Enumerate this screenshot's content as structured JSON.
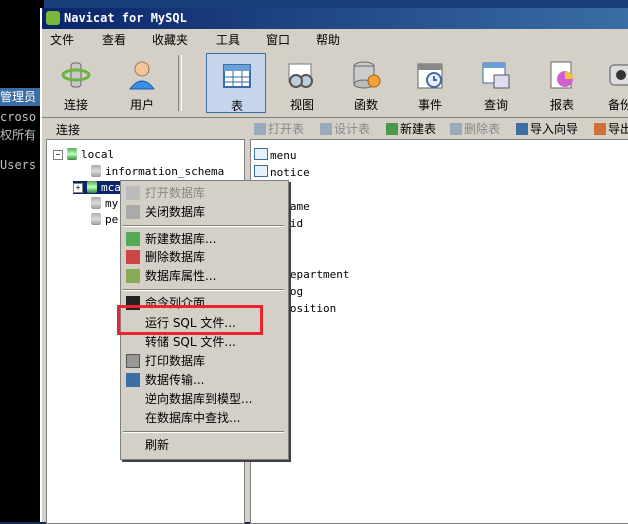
{
  "background": {
    "cmd_title": "管理员",
    "cmd_lines": [
      "croso",
      "权所有",
      "",
      "Users"
    ]
  },
  "window": {
    "title": "Navicat for MySQL"
  },
  "menubar": [
    "文件",
    "查看",
    "收藏夹",
    "工具",
    "窗口",
    "帮助"
  ],
  "toolbar": [
    {
      "label": "连接",
      "icon": "connection-icon"
    },
    {
      "label": "用户",
      "icon": "user-icon"
    },
    {
      "label": "表",
      "icon": "table-icon",
      "active": true
    },
    {
      "label": "视图",
      "icon": "view-icon"
    },
    {
      "label": "函数",
      "icon": "function-icon"
    },
    {
      "label": "事件",
      "icon": "event-icon"
    },
    {
      "label": "查询",
      "icon": "query-icon"
    },
    {
      "label": "报表",
      "icon": "report-icon"
    },
    {
      "label": "备份",
      "icon": "backup-icon"
    }
  ],
  "subbar": {
    "connection_label": "连接",
    "buttons": [
      {
        "label": "打开表",
        "disabled": true
      },
      {
        "label": "设计表",
        "disabled": true
      },
      {
        "label": "新建表",
        "disabled": false
      },
      {
        "label": "删除表",
        "disabled": true
      },
      {
        "label": "导入向导",
        "disabled": false
      },
      {
        "label": "导出",
        "disabled": false
      }
    ]
  },
  "tree": {
    "root": "local",
    "databases": [
      "information_schema",
      "mcadmin",
      "my",
      "pe"
    ]
  },
  "objects": [
    "menu",
    "notice",
    "le",
    "e_name",
    "cusid",
    "eid",
    "",
    "r_department",
    "r_log",
    "r_position"
  ],
  "context_menu": {
    "items": [
      {
        "label": "打开数据库",
        "disabled": true
      },
      {
        "label": "关闭数据库",
        "disabled": false
      },
      {
        "sep": true
      },
      {
        "label": "新建数据库...",
        "disabled": false
      },
      {
        "label": "删除数据库",
        "disabled": false
      },
      {
        "label": "数据库属性...",
        "disabled": false
      },
      {
        "sep": true
      },
      {
        "label": "命令列介面",
        "disabled": false
      },
      {
        "label": "运行 SQL 文件...",
        "disabled": false
      },
      {
        "label": "转储 SQL 文件...",
        "disabled": false
      },
      {
        "label": "打印数据库",
        "disabled": false
      },
      {
        "label": "数据传输...",
        "disabled": false
      },
      {
        "label": "逆向数据库到模型...",
        "disabled": false
      },
      {
        "label": "在数据库中查找...",
        "disabled": false
      },
      {
        "sep": true
      },
      {
        "label": "刷新",
        "disabled": false
      }
    ]
  },
  "colors": {
    "highlight": "#e8262c",
    "title_start": "#0a246a",
    "title_end": "#3a6ea5"
  }
}
